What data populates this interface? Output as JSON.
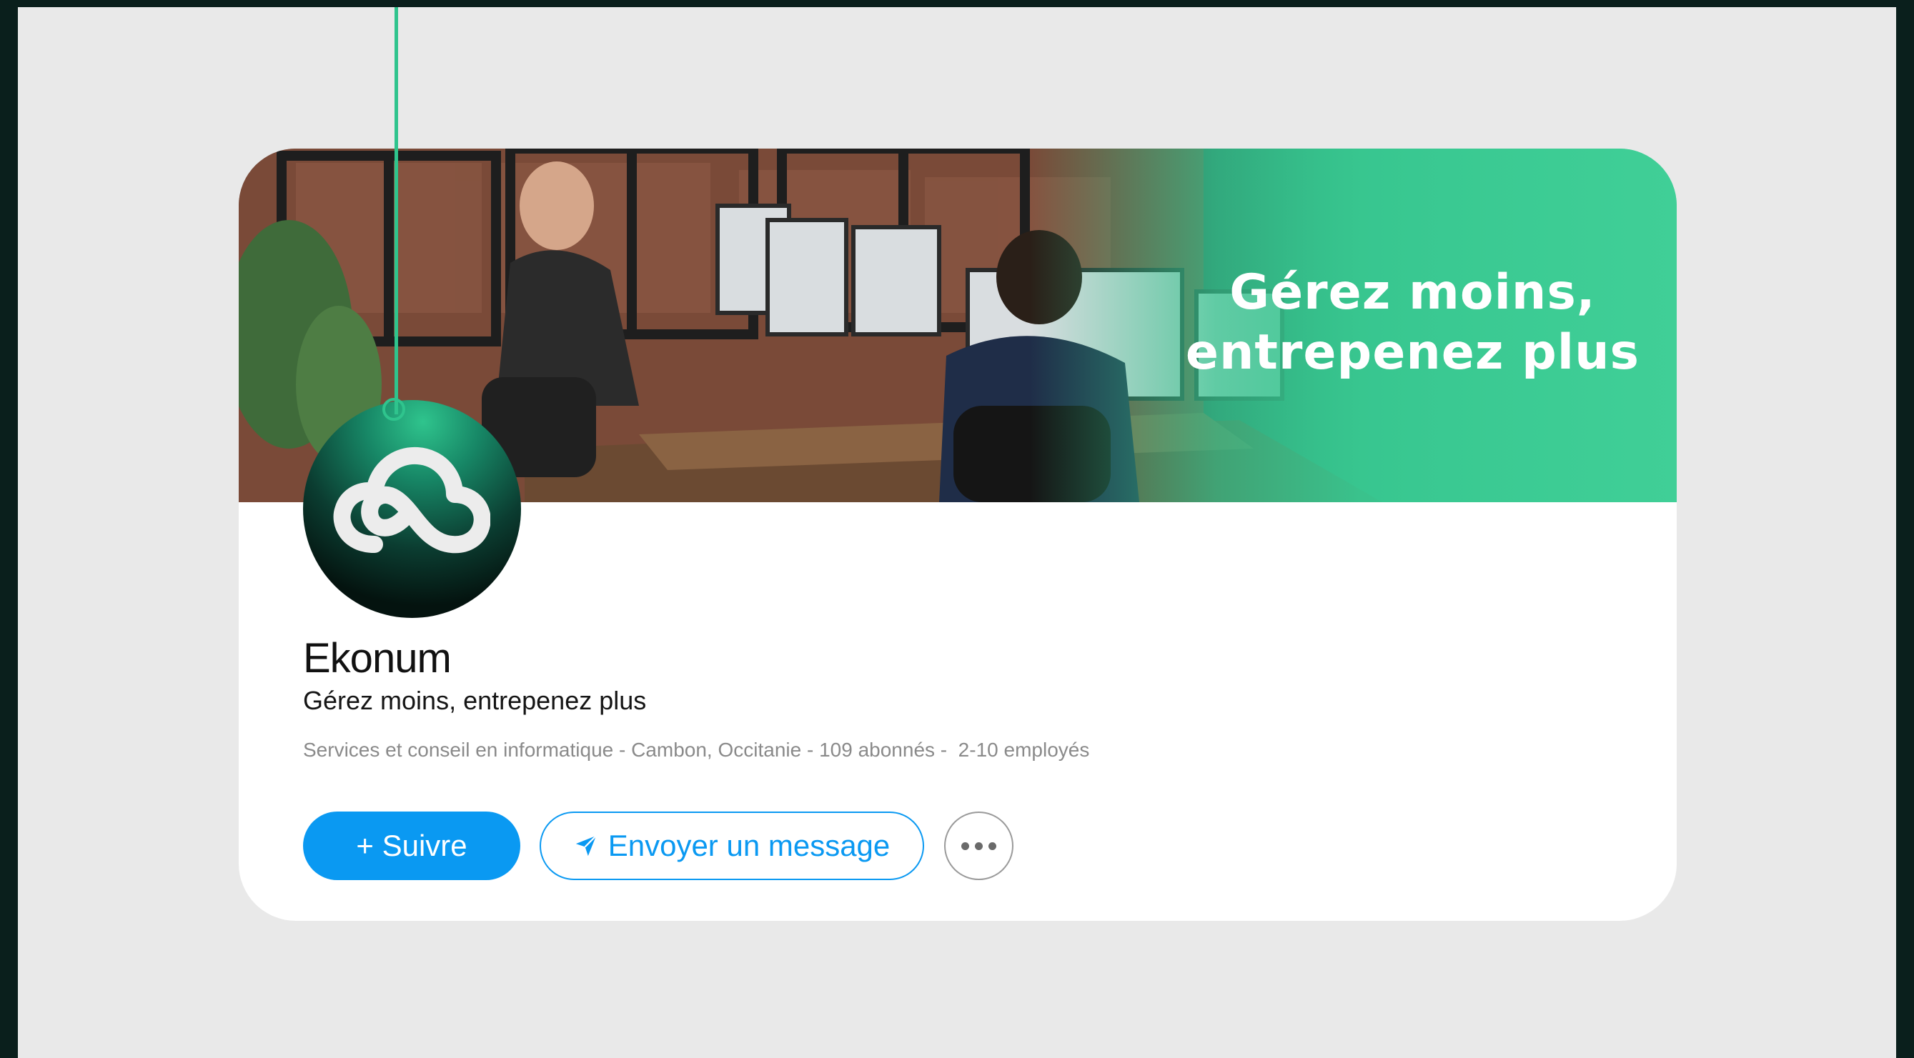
{
  "banner": {
    "headline_line1": "Gérez moins,",
    "headline_line2": "entrepenez plus"
  },
  "company": {
    "name": "Ekonum",
    "tagline": "Gérez moins, entrepenez plus",
    "meta": "Services et conseil en informatique - Cambon, Occitanie - 109 abonnés -  2-10 employés",
    "logo_icon": "cloud-infinity-icon"
  },
  "actions": {
    "follow_label": "+ Suivre",
    "message_label": "Envoyer un message",
    "message_icon": "send-arrow-icon",
    "more_icon": "more-dots-icon"
  },
  "colors": {
    "accent_green": "#2fc48d",
    "primary_blue": "#0a99f2",
    "frame": "#0a1f1c",
    "background": "#e9e9e9"
  }
}
